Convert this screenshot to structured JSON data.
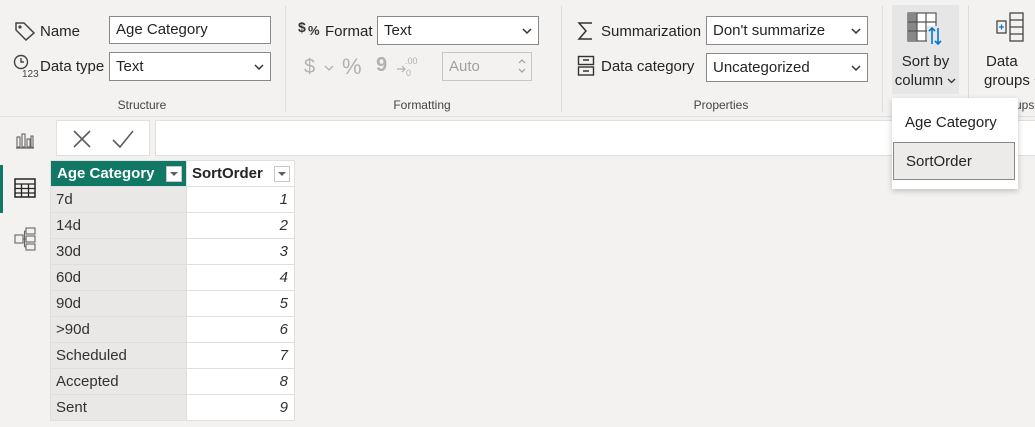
{
  "ribbon": {
    "structure": {
      "name_label": "Name",
      "name_value": "Age Category",
      "datatype_label": "Data type",
      "datatype_value": "Text",
      "group_label": "Structure"
    },
    "formatting": {
      "format_label": "Format",
      "format_value": "Text",
      "currency_symbol": "$",
      "percent_symbol": "%",
      "comma_symbol": "9",
      "decimal_places": "Auto",
      "group_label": "Formatting"
    },
    "properties": {
      "summarization_label": "Summarization",
      "summarization_value": "Don't summarize",
      "datacategory_label": "Data category",
      "datacategory_value": "Uncategorized",
      "group_label": "Properties"
    },
    "sort": {
      "line1": "Sort by",
      "line2": "column"
    },
    "data_groups": {
      "line1": "Data",
      "line2": "groups",
      "group_label_partial": "ups"
    }
  },
  "sort_menu": {
    "items": [
      "Age Category",
      "SortOrder"
    ],
    "selected": "SortOrder"
  },
  "table": {
    "columns": [
      "Age Category",
      "SortOrder"
    ],
    "rows": [
      [
        "7d",
        "1"
      ],
      [
        "14d",
        "2"
      ],
      [
        "30d",
        "3"
      ],
      [
        "60d",
        "4"
      ],
      [
        "90d",
        "5"
      ],
      [
        ">90d",
        "6"
      ],
      [
        "Scheduled",
        "7"
      ],
      [
        "Accepted",
        "8"
      ],
      [
        "Sent",
        "9"
      ]
    ]
  },
  "colors": {
    "accent": "#117865",
    "selected_header_text": "#ffffff"
  },
  "icons": [
    "tag-icon",
    "datatype-icon",
    "format-icon",
    "currency-icon",
    "percent-icon",
    "comma-icon",
    "decimal-icon",
    "sigma-icon",
    "data-category-icon",
    "sort-by-column-icon",
    "data-groups-icon",
    "report-view-icon",
    "table-view-icon",
    "model-view-icon",
    "close-icon",
    "check-icon"
  ]
}
